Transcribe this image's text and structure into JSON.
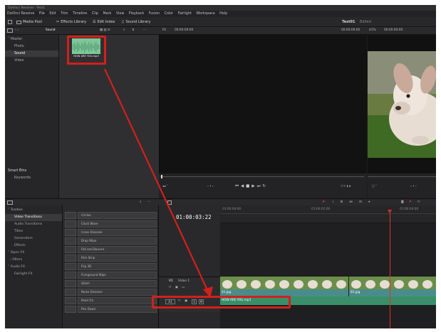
{
  "window": {
    "title": "DaVinci Resolve - Test1"
  },
  "menu": [
    "DaVinci Resolve",
    "File",
    "Edit",
    "Trim",
    "Timeline",
    "Clip",
    "Mark",
    "View",
    "Playback",
    "Fusion",
    "Color",
    "Fairlight",
    "Workspace",
    "Help"
  ],
  "toolbar": {
    "media_pool": "Media Pool",
    "effects_library": "Effects Library",
    "edit_index": "Edit Index",
    "sound_library": "Sound Library",
    "project_name": "Test01",
    "project_status": "Edited"
  },
  "subbar": {
    "bin_name": "Sound",
    "viewer_mode": "Fit",
    "viewer_timecode": "00:00:00:00",
    "source_timecode": "00:00:00:00",
    "zoom": "41%",
    "program_timecode": "00:00:00:00"
  },
  "bins": {
    "master": "Master",
    "items": [
      "Photo",
      "Sound",
      "Video"
    ],
    "selected": "Sound",
    "smart_bins": "Smart Bins",
    "keywords": "Keywords"
  },
  "media": {
    "clip_name": "HOW ARE YOU.mp3"
  },
  "effects_tree": {
    "toolbox": "Toolbox",
    "items": [
      "Video Transitions",
      "Audio Transitions",
      "Titles",
      "Generators",
      "Effects"
    ],
    "selected": "Video Transitions",
    "open_fx": "Open FX",
    "filters": "Filters",
    "audio_fx": "Audio FX",
    "fairlight_fx": "Fairlight FX"
  },
  "transitions": [
    "Circles",
    "Clock Wave",
    "Cross Dissolve",
    "Drop Wipe",
    "Fall and Bounce",
    "Film Strip",
    "Flip 3D",
    "Foreground Wipe",
    "Glitch",
    "Noise Dissolve",
    "Paint On",
    "Pan Down"
  ],
  "timeline": {
    "timecode": "01:00:03:22",
    "ruler": [
      "01:00:00:00",
      "01:00:02:00",
      "01:00:04:00"
    ],
    "video_track": {
      "id": "V1",
      "name": "Video 1",
      "clip1": "A1.jpg",
      "clip2": "B1.jpg"
    },
    "audio_track": {
      "id": "A1",
      "clip": "HOW ARE YOU.mp3"
    }
  },
  "colors": {
    "accent": "#d2201b",
    "video_clip": "#4a8c8a",
    "audio_clip": "#3a8f6a"
  }
}
